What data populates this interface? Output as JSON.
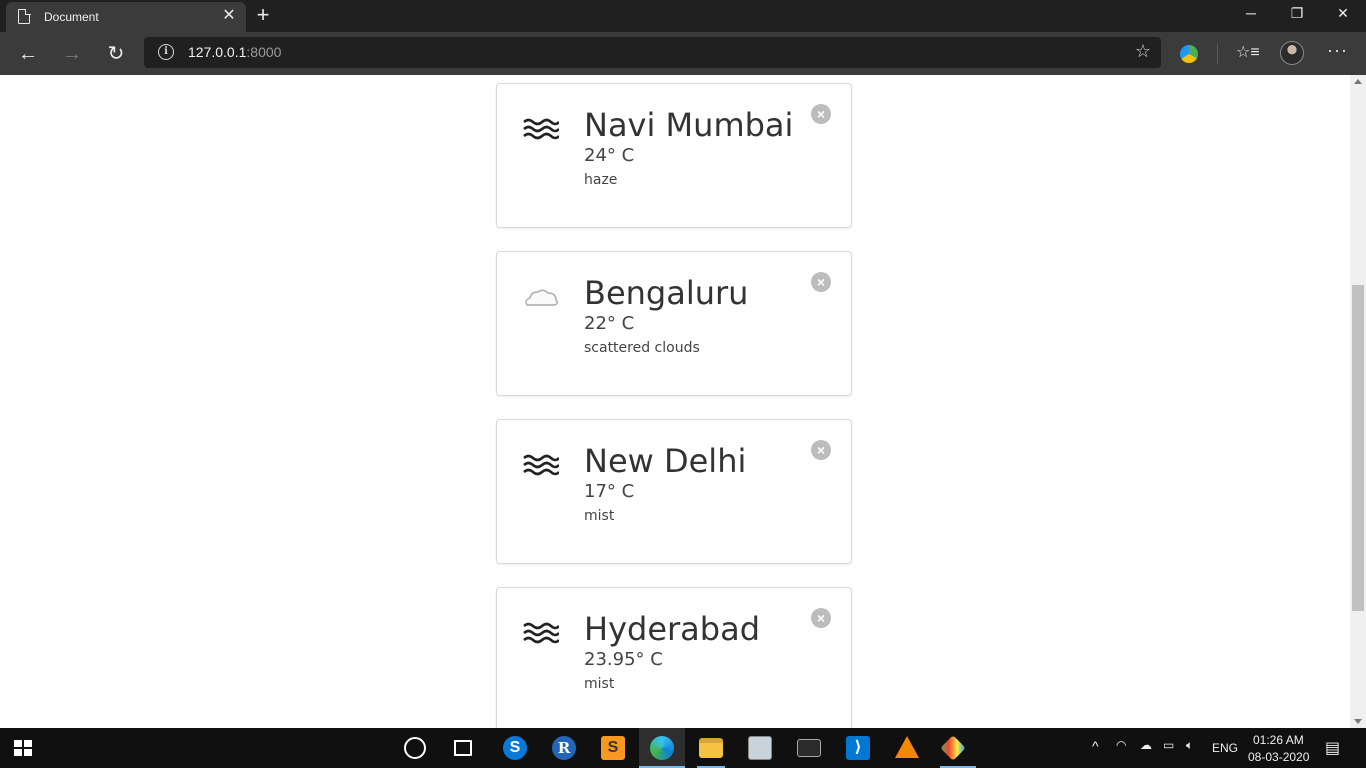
{
  "browser": {
    "tab_title": "Document",
    "url_host": "127.0.0.1",
    "url_port": ":8000"
  },
  "cards": [
    {
      "city": "Navi Mumbai",
      "temp": "24° C",
      "desc": "haze",
      "icon": "haze-icon"
    },
    {
      "city": "Bengaluru",
      "temp": "22° C",
      "desc": "scattered clouds",
      "icon": "cloud-icon"
    },
    {
      "city": "New Delhi",
      "temp": "17° C",
      "desc": "mist",
      "icon": "mist-icon"
    },
    {
      "city": "Hyderabad",
      "temp": "23.95° C",
      "desc": "mist",
      "icon": "mist-icon"
    }
  ],
  "taskbar": {
    "language": "ENG",
    "time": "01:26 AM",
    "date": "08-03-2020"
  },
  "colors": {
    "titlebar": "#202020",
    "toolbar": "#3b3b3b",
    "taskbar": "#101010",
    "card_border": "#d9d9d9",
    "close_button": "#bcbcbc"
  }
}
